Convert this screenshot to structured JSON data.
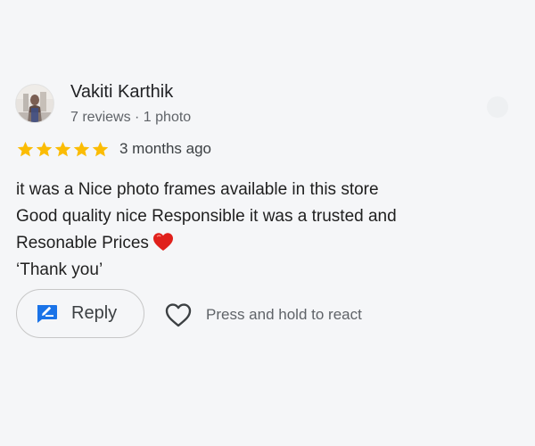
{
  "review": {
    "reviewer_name": "Vakiti Karthik",
    "reviewer_meta": "7 reviews · 1 photo",
    "rating": 5,
    "rating_max": 5,
    "review_age": "3 months ago",
    "text_lines": [
      "it was a Nice photo frames available in this store",
      "Good quality nice Responsible it was a trusted and",
      "Resonable Prices",
      "‘Thank you’"
    ],
    "emoji": "red-heart-emoji"
  },
  "actions": {
    "reply_label": "Reply",
    "reply_icon": "reply-edit-icon",
    "react_icon": "heart-outline-icon",
    "react_hint": "Press and hold to react"
  },
  "colors": {
    "star": "#fbbc04",
    "accent_blue": "#1a73e8",
    "heart_red": "#e0201b",
    "secondary_text": "#5f6368"
  }
}
